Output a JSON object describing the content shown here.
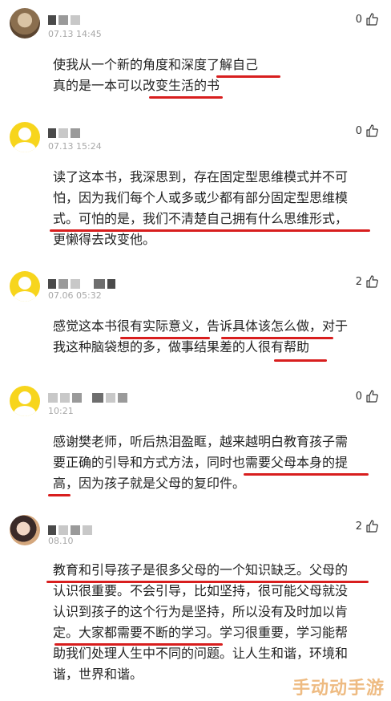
{
  "comments": [
    {
      "time": "07.13 14:45",
      "likes": "0",
      "lines": [
        "使我从一个新的角度和深度了解自己",
        "真的是一本可以改变生活的书"
      ]
    },
    {
      "time": "07.13 15:24",
      "likes": "0",
      "lines": [
        "读了这本书，我深思到，存在固定型思维模式并不可",
        "怕，因为我们每个人或多或少都有部分固定型思维模",
        "式。可怕的是，我们不清楚自己拥有什么思维形式，",
        "更懒得去改变他。"
      ]
    },
    {
      "time": "07.06 05:32",
      "likes": "2",
      "lines": [
        "感觉这本书很有实际意义，告诉具体该怎么做，对于",
        "我这种脑袋想的多，做事结果差的人很有帮助"
      ]
    },
    {
      "time": "10:21",
      "likes": "0",
      "lines": [
        "感谢樊老师，听后热泪盈眶，越来越明白教育孩子需",
        "要正确的引导和方式方法，同时也需要父母本身的提",
        "高，因为孩子就是父母的复印件。"
      ]
    },
    {
      "time": "08.10",
      "likes": "2",
      "lines": [
        "教育和引导孩子是很多父母的一个知识缺乏。父母的",
        "认识很重要。不会引导，比如坚持，很可能父母就没",
        "认识到孩子的这个行为是坚持，所以没有及时加以肯",
        "定。大家都需要不断的学习。学习很重要，学习能帮",
        "助我们处理人生中不同的问题。让人生和谐，环境和",
        "谐，世界和谐。"
      ]
    }
  ],
  "watermark": "手动动手游",
  "colors": {
    "underline": "#d81e1e",
    "avatar_yellow": "#f7d51d",
    "meta_gray": "#a8a8a8"
  }
}
